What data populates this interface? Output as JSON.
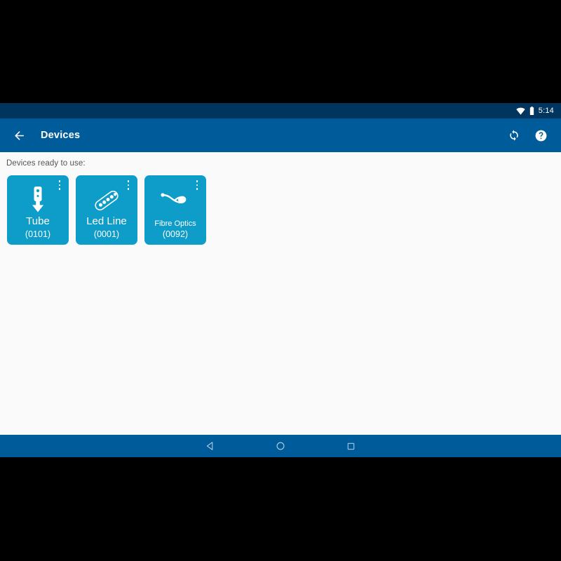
{
  "status_bar": {
    "wifi_icon": "wifi-icon",
    "battery_icon": "battery-icon",
    "clock": "5:14"
  },
  "toolbar": {
    "back_icon": "back-arrow-icon",
    "title": "Devices",
    "refresh_icon": "refresh-icon",
    "help_icon": "help-icon"
  },
  "content": {
    "section_label": "Devices ready to use:",
    "card_color": "#0e9cc9",
    "background_color": "#fafafa",
    "devices": [
      {
        "name": "Tube",
        "code": "(0101)",
        "icon": "tube-icon",
        "overflow_icon": "overflow-menu-icon"
      },
      {
        "name": "Led Line",
        "code": "(0001)",
        "icon": "led-line-icon",
        "overflow_icon": "overflow-menu-icon"
      },
      {
        "name": "Fibre Optics",
        "code": "(0092)",
        "icon": "fibre-optics-icon",
        "overflow_icon": "overflow-menu-icon"
      }
    ]
  },
  "nav_bar": {
    "back_icon": "nav-back-icon",
    "home_icon": "nav-home-icon",
    "recents_icon": "nav-recents-icon"
  }
}
